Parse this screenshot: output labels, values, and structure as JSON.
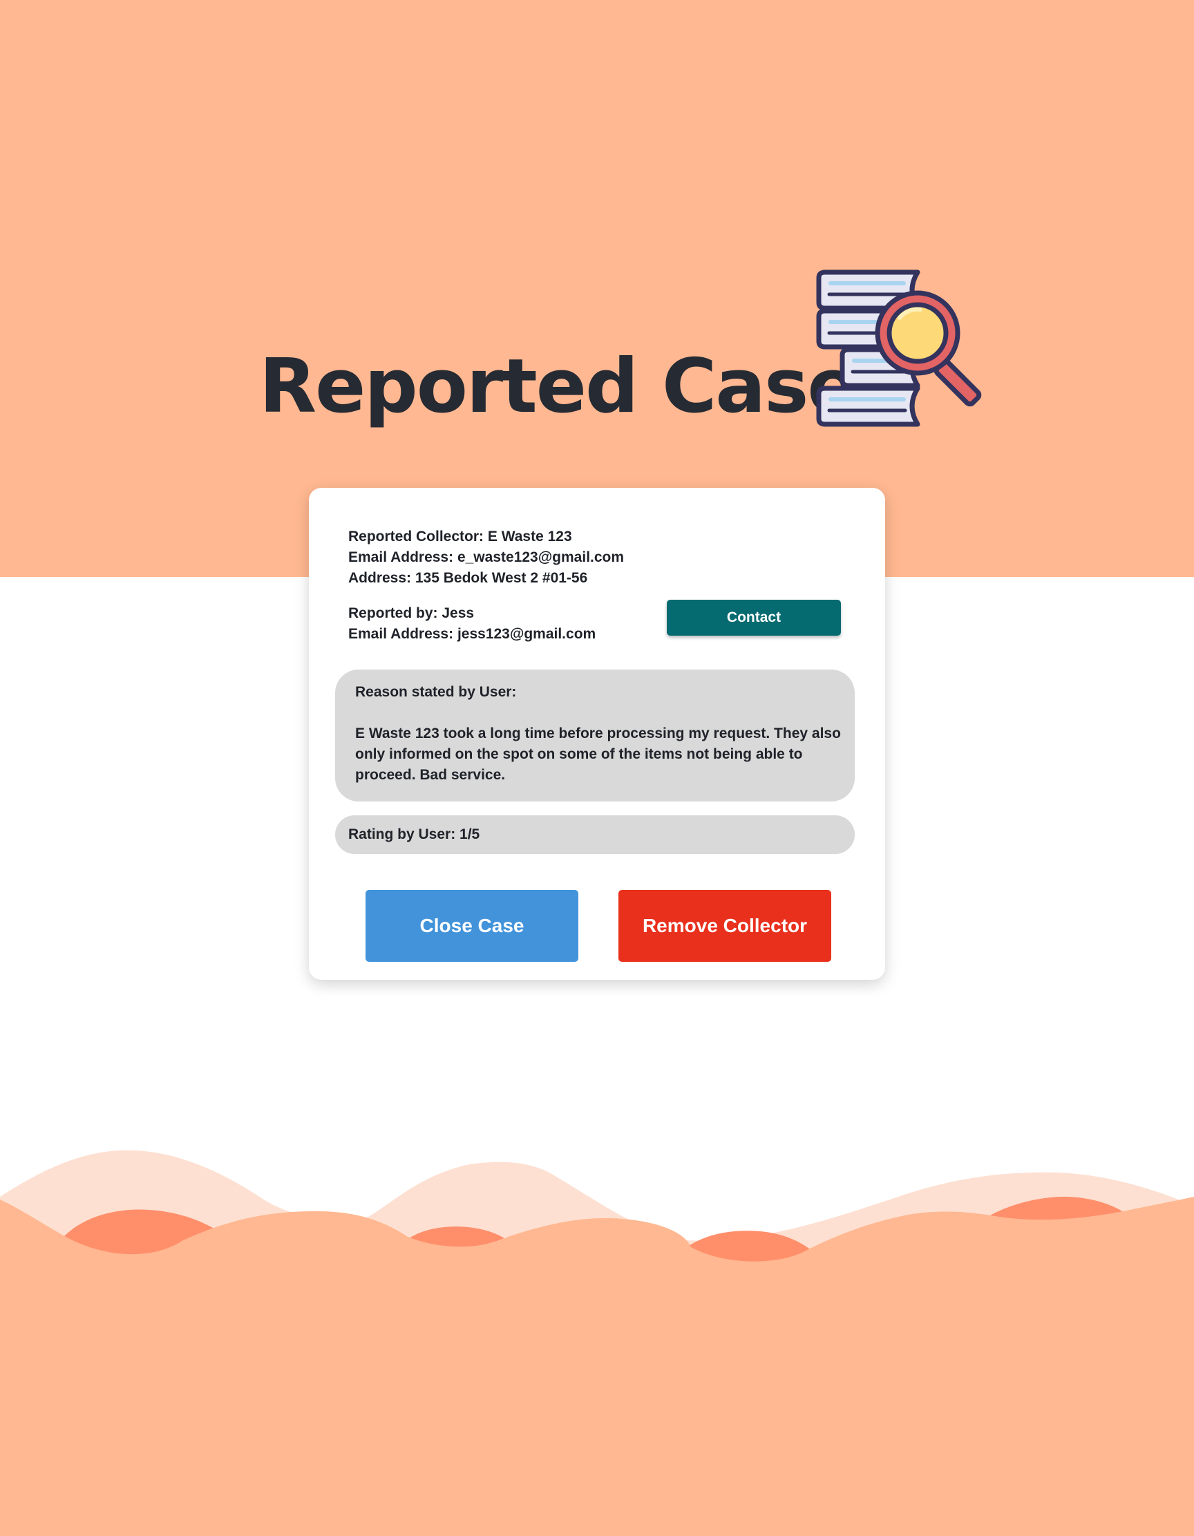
{
  "header": {
    "title": "Reported Case",
    "illustration": "books-magnifier-icon"
  },
  "card": {
    "collector": {
      "name_line": "Reported Collector: E Waste 123",
      "email_line": "Email Address: e_waste123@gmail.com",
      "address_line": "Address: 135 Bedok West 2 #01-56"
    },
    "reporter": {
      "name_line": "Reported by: Jess",
      "email_line": "Email Address: jess123@gmail.com"
    },
    "contact_label": "Contact",
    "reason": {
      "heading": "Reason stated by User:",
      "text": "E Waste 123 took a long time before processing my request. They also only informed on the spot on some of the items not being able to proceed. Bad service."
    },
    "rating": {
      "text": "Rating by User: 1/5",
      "value": 1,
      "max": 5
    },
    "close_case_label": "Close Case",
    "remove_collector_label": "Remove Collector"
  },
  "colors": {
    "band": "#ffb891",
    "wave_light": "#fde0d2",
    "wave_dark": "#ff8f6b",
    "contact": "#056b70",
    "close_case": "#4293da",
    "remove_collector": "#e8301d",
    "panel_gray": "#d9d9d9",
    "title": "#262a33"
  }
}
